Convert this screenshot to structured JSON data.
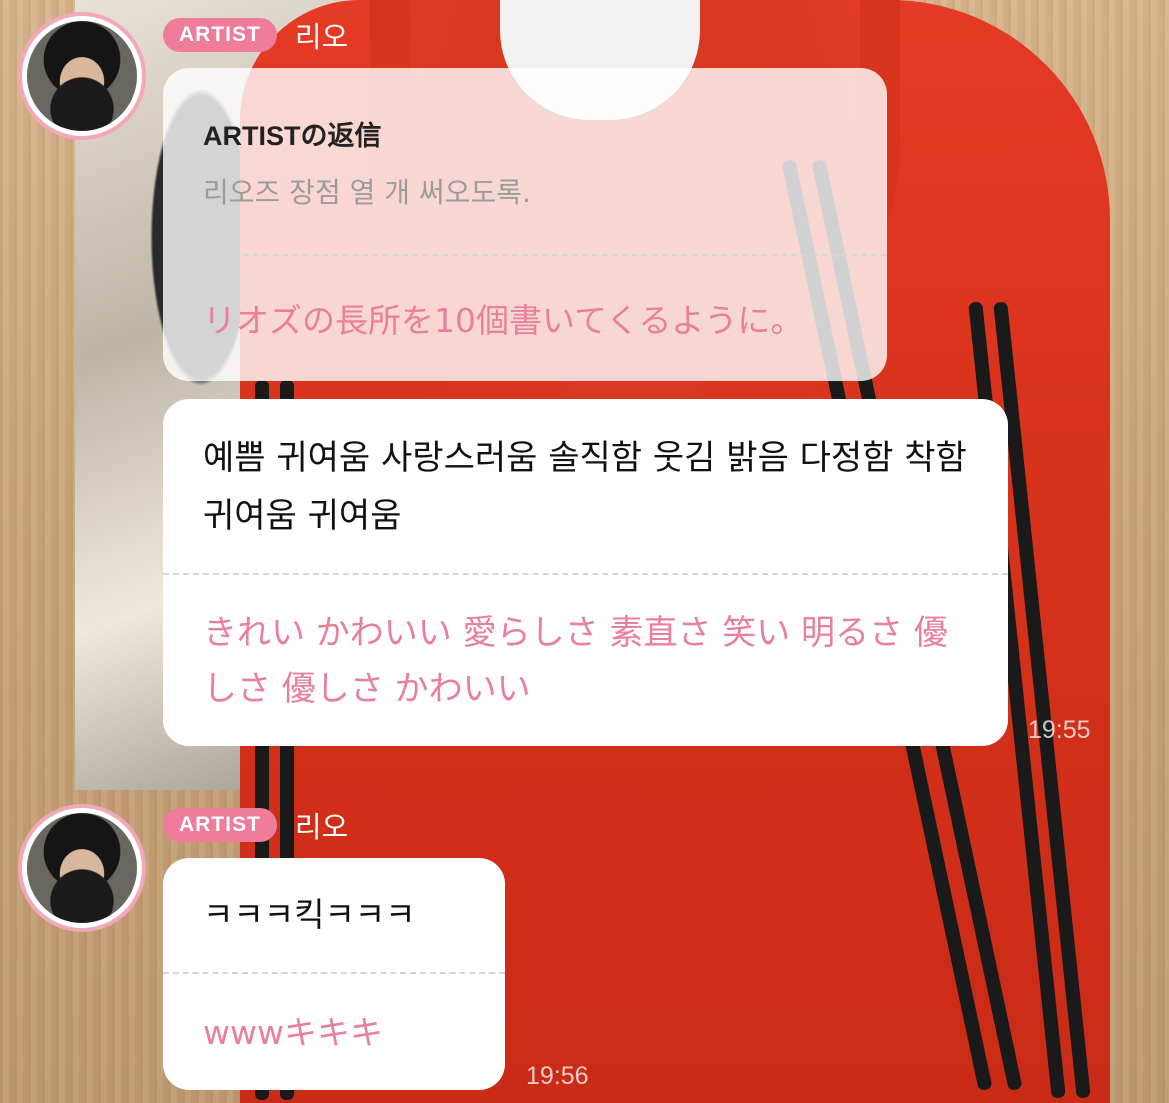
{
  "messages": [
    {
      "badge": "ARTIST",
      "name": "리오",
      "reply_label": "ARTISTの返信",
      "reply_original": "리오즈 장점 열 개 써오도록.",
      "reply_translation": "リオズの長所を10個書いてくるように。",
      "original": "예쁨 귀여움 사랑스러움 솔직함 웃김 밝음 다정함 착함 귀여움 귀여움",
      "translation": "きれい かわいい 愛らしさ 素直さ 笑い 明るさ 優しさ 優しさ かわいい",
      "time": "19:55"
    },
    {
      "badge": "ARTIST",
      "name": "리오",
      "original": "ㅋㅋㅋ킥ㅋㅋㅋ",
      "translation": "wwwキキキ",
      "time": "19:56"
    }
  ],
  "colors": {
    "accent_pink": "#f07c9b",
    "translation_pink": "#ea7f9c",
    "avatar_ring": "#f4a7b9"
  }
}
